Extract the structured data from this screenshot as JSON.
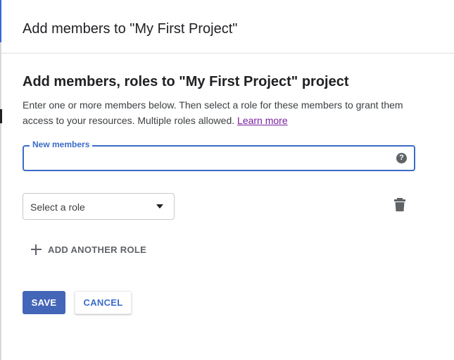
{
  "header": {
    "title": "Add members to \"My First Project\""
  },
  "section": {
    "title": "Add members, roles to \"My First Project\" project",
    "description": "Enter one or more members below. Then select a role for these members to grant them access to your resources. Multiple roles allowed.",
    "learn_more": "Learn more"
  },
  "members_field": {
    "label": "New members",
    "value": "",
    "help_icon": "?"
  },
  "role": {
    "placeholder": "Select a role",
    "dropdown_icon": "arrow-drop-down-icon",
    "delete_icon": "trash-icon"
  },
  "add_role": {
    "label": "ADD ANOTHER ROLE",
    "icon": "plus-icon"
  },
  "actions": {
    "save": "SAVE",
    "cancel": "CANCEL"
  },
  "colors": {
    "accent": "#3c6cc8",
    "save_bg": "#4466b8",
    "link": "#7b1fa2"
  }
}
